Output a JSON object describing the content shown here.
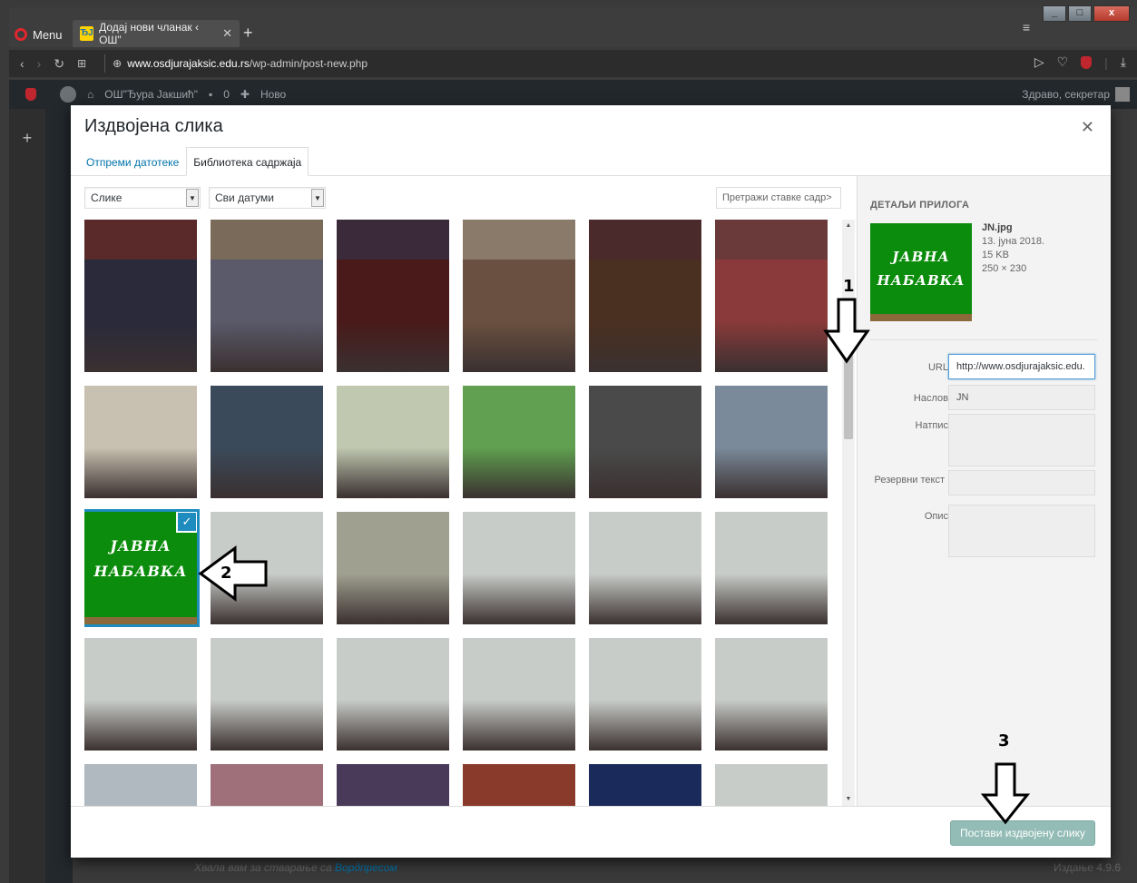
{
  "browser": {
    "menu_label": "Menu",
    "tab_title": "Додај нови чланак ‹ ОШ\"",
    "tab_favicon": "ЂЈ",
    "url_domain": "www.osdjurajaksic.edu.rs",
    "url_path": "/wp-admin/post-new.php"
  },
  "wp_admin_bar": {
    "site_name": "ОШ\"Ђура Јакшић\"",
    "comments_count": "0",
    "new_label": "Ново",
    "greeting": "Здраво, секретар"
  },
  "modal": {
    "title": "Издвојена слика",
    "tabs": [
      {
        "label": "Отпреми датотеке",
        "active": false
      },
      {
        "label": "Библиотека садржаја",
        "active": true
      }
    ],
    "filter_type": "Слике",
    "filter_date": "Сви датуми",
    "search_placeholder": "Претражи ставке садр>",
    "selected_image_text_line1": "ЈАВНА",
    "selected_image_text_line2": "НАБАВКА",
    "details": {
      "heading": "Детаљи прилога",
      "filename": "JN.jpg",
      "date": "13. јуна 2018.",
      "size": "15 KB",
      "dimensions": "250 × 230",
      "fields": [
        {
          "label": "URL",
          "value": "http://www.osdjurajaksic.edu."
        },
        {
          "label": "Наслов",
          "value": "JN"
        },
        {
          "label": "Натпис",
          "value": ""
        },
        {
          "label": "Резервни текст",
          "value": ""
        },
        {
          "label": "Опис",
          "value": ""
        }
      ]
    },
    "button_set_featured": "Постави издвојену слику"
  },
  "footer": {
    "thanks": "Хвала вам за стварање са ",
    "thanks_link": "Вордпресом",
    "version": "Издање 4.9.6"
  },
  "annotations": [
    "1",
    "2",
    "3"
  ],
  "colors": {
    "accent": "#1e8cbe",
    "green_image": "#0c8c0c",
    "button": "#7fb1a9"
  }
}
